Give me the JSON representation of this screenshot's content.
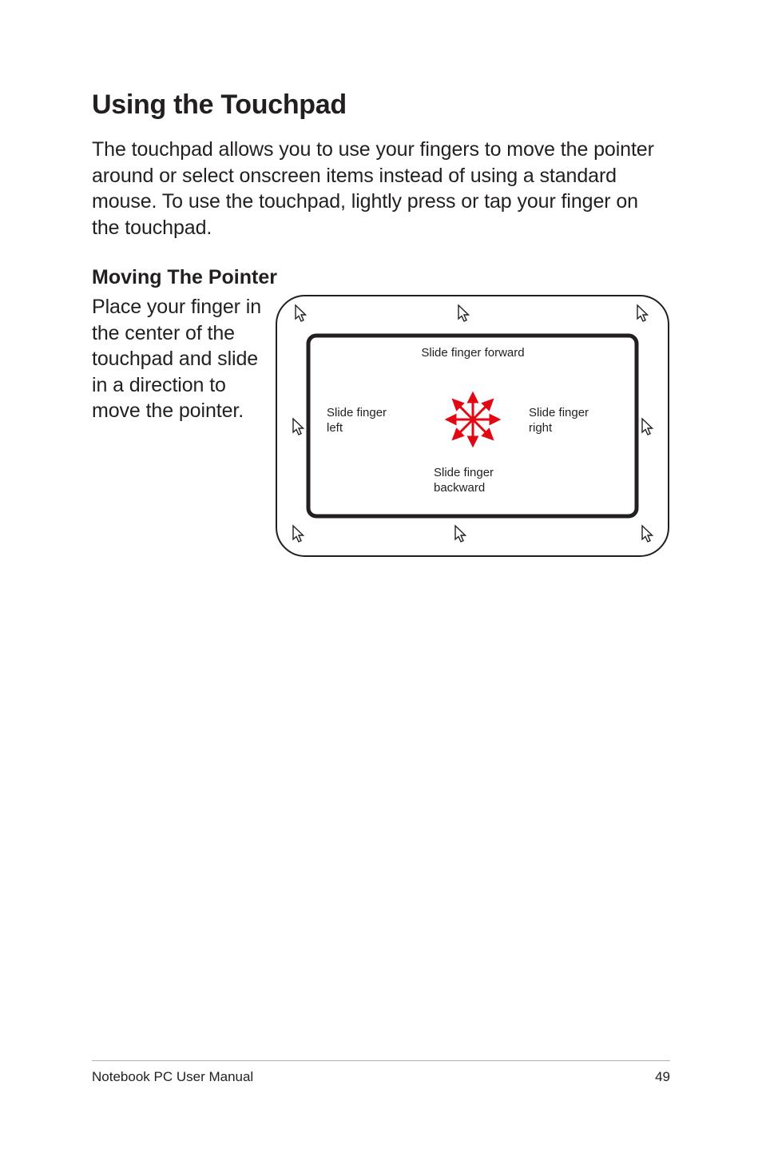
{
  "headings": {
    "title": "Using the Touchpad",
    "subheading": "Moving The Pointer"
  },
  "paragraphs": {
    "intro": "The touchpad allows you to use your fingers to move the pointer around or select onscreen items instead of using a standard mouse. To use the touchpad, lightly press or tap your finger on the touchpad.",
    "moving": "Place your finger in the center of the touchpad and slide in a direction to move the pointer."
  },
  "diagram": {
    "label_forward": "Slide finger forward",
    "label_left_1": "Slide finger",
    "label_left_2": "left",
    "label_right_1": "Slide finger",
    "label_right_2": "right",
    "label_backward_1": "Slide finger",
    "label_backward_2": "backward"
  },
  "footer": {
    "manual_name": "Notebook PC User Manual",
    "page_number": "49"
  }
}
